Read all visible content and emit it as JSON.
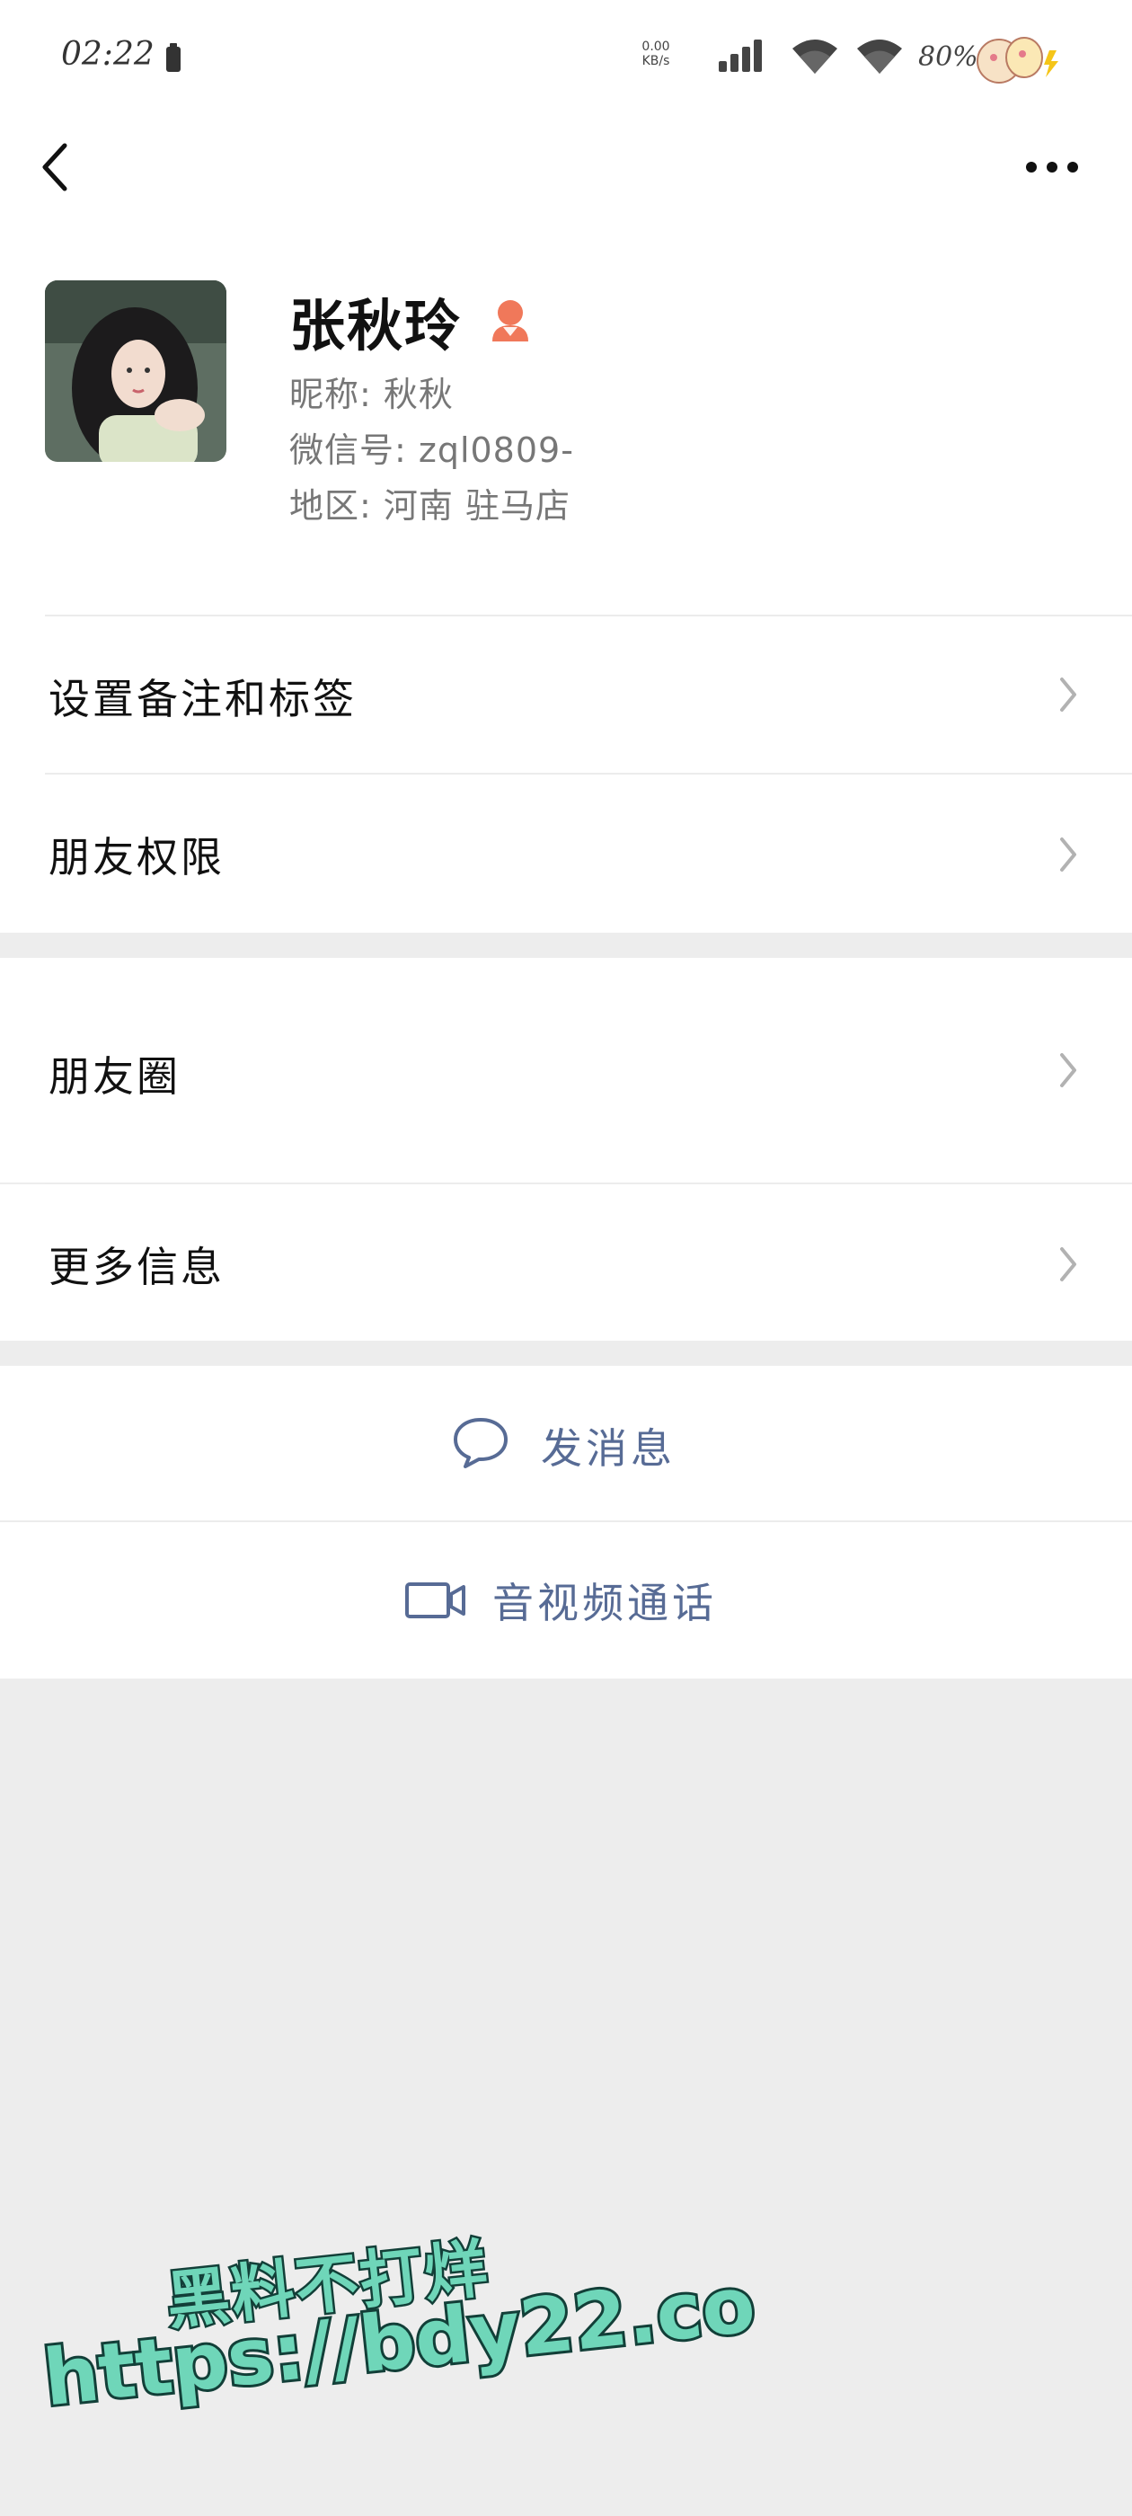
{
  "status_bar": {
    "time": "02:22",
    "net_speed_value": "0.00",
    "net_speed_unit": "KB/s",
    "battery_percent": "80%"
  },
  "nav": {
    "back_icon": "chevron-left-icon",
    "more_icon": "ellipsis-icon"
  },
  "profile": {
    "name": "张秋玲",
    "gender_icon": "female-icon",
    "gender_color": "#f0785a",
    "nickname": "昵称: 秋秋",
    "wechat_id": "微信号: zql0809-",
    "region": "地区: 河南 驻马店"
  },
  "menu": {
    "remark_tags": "设置备注和标签",
    "friend_permissions": "朋友权限",
    "moments": "朋友圈",
    "more_info": "更多信息"
  },
  "actions": {
    "send_message": "发消息",
    "video_call": "音视频通话",
    "link_color": "#576b95"
  },
  "watermark": {
    "text_cn": "黑料不打烊",
    "url": "https://bdy22.co"
  }
}
